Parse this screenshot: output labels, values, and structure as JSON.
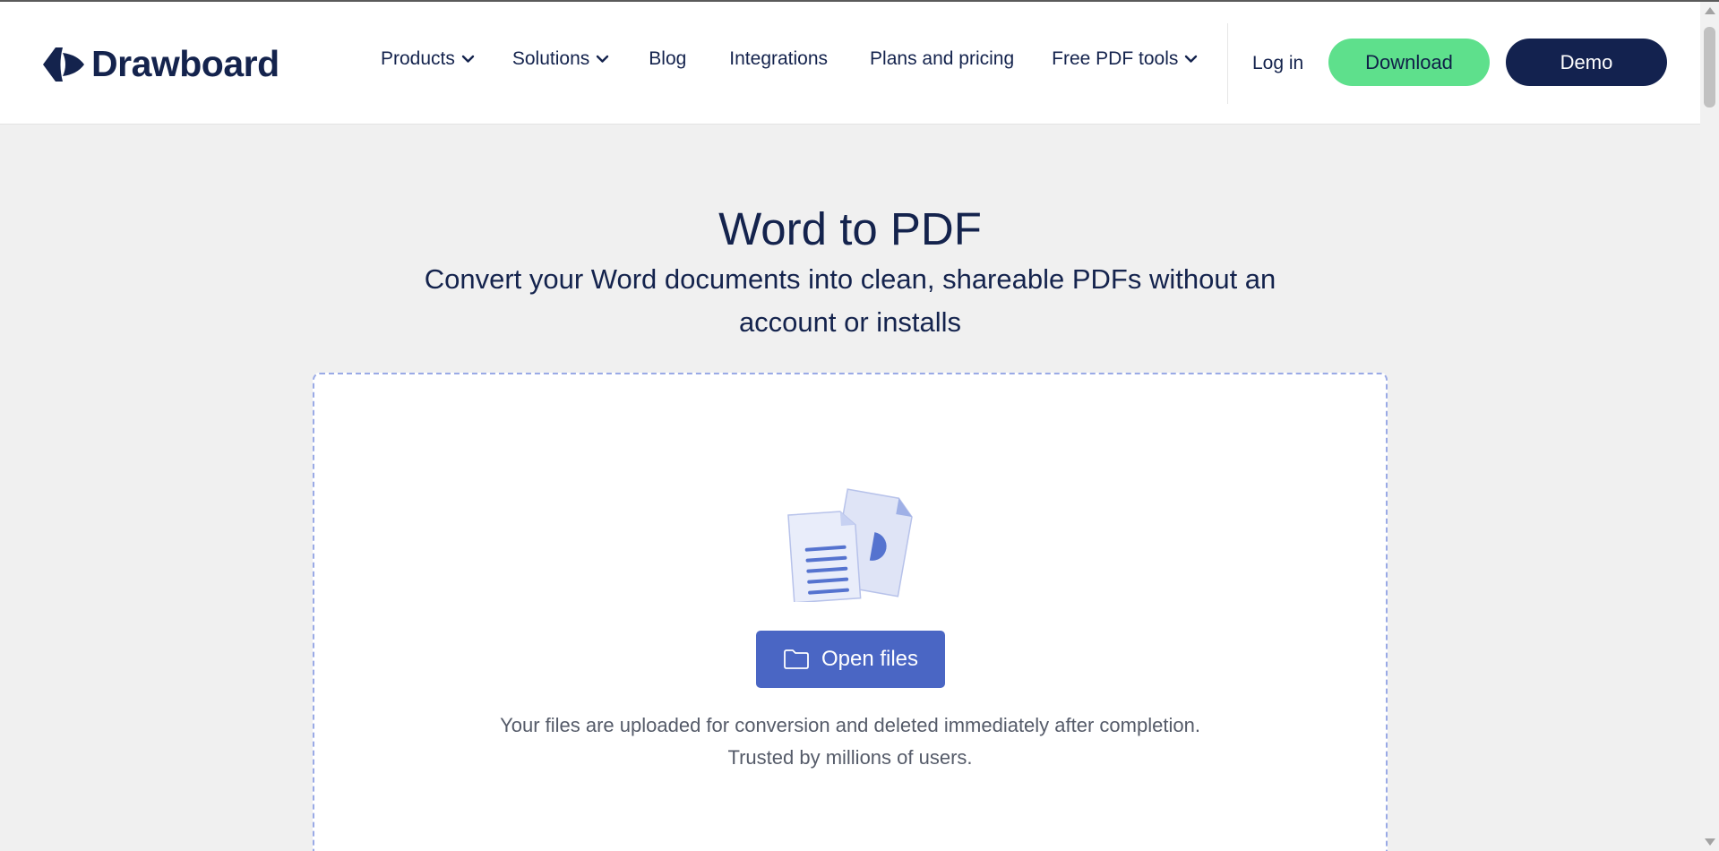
{
  "brand": {
    "name": "Drawboard",
    "logo_icon": "drawboard-logo-icon",
    "color": "#14234d"
  },
  "nav": {
    "items": [
      {
        "label": "Products",
        "has_dropdown": true
      },
      {
        "label": "Solutions",
        "has_dropdown": true
      },
      {
        "label": "Blog",
        "has_dropdown": false
      },
      {
        "label": "Integrations",
        "has_dropdown": false
      },
      {
        "label": "Plans and pricing",
        "has_dropdown": false
      },
      {
        "label": "Free PDF tools",
        "has_dropdown": true
      }
    ],
    "login_label": "Log in",
    "download_label": "Download",
    "demo_label": "Demo"
  },
  "hero": {
    "title": "Word to PDF",
    "subtitle": "Convert your Word documents into clean, shareable PDFs without an account or installs"
  },
  "dropzone": {
    "illustration": "documents-illustration",
    "open_button_label": "Open files",
    "open_button_icon": "folder-icon",
    "note_line1": "Your files are uploaded for conversion and deleted immediately after completion.",
    "note_line2": "Trusted by millions of users."
  },
  "colors": {
    "download_bg": "#5ee08c",
    "demo_bg": "#13224f",
    "open_button_bg": "#4a66c4",
    "page_bg": "#f0f0f0",
    "dropzone_border": "#9aaae6"
  }
}
